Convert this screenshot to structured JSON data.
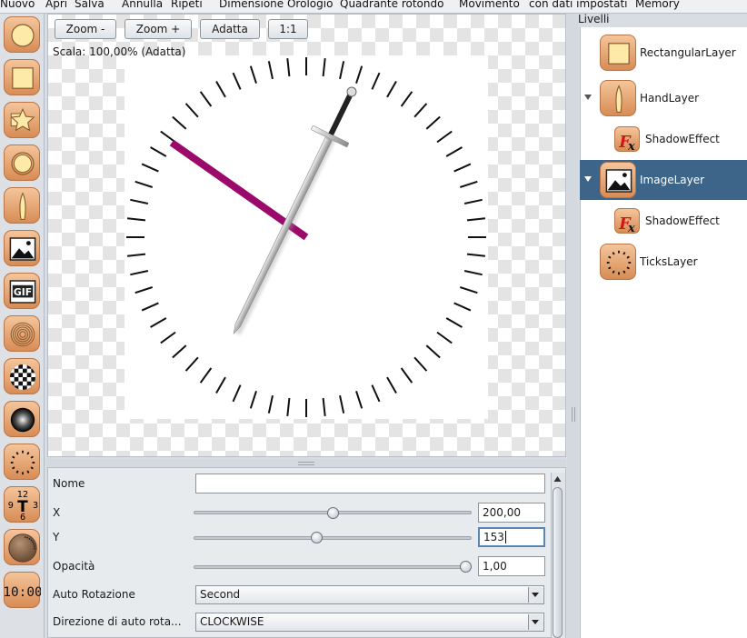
{
  "menubar": {
    "items": [
      "Nuovo",
      "Apri",
      "Salva",
      "Annulla",
      "Ripeti",
      "Dimensione Orologio",
      "Quadrante rotondo",
      "Movimento",
      "con dati impostati",
      "Memory"
    ]
  },
  "palette": {
    "tools": [
      {
        "name": "ellipse-layer-tool",
        "icon": "circle-icon"
      },
      {
        "name": "rectangle-layer-tool",
        "icon": "square-icon"
      },
      {
        "name": "shape-layer-tool",
        "icon": "star-icon"
      },
      {
        "name": "ring-layer-tool",
        "icon": "ring-icon"
      },
      {
        "name": "hand-layer-tool",
        "icon": "hand-icon"
      },
      {
        "name": "image-layer-tool",
        "icon": "image-icon"
      },
      {
        "name": "gif-layer-tool",
        "icon": "gif-icon"
      },
      {
        "name": "concentric-layer-tool",
        "icon": "concentric-circles-icon"
      },
      {
        "name": "checker-layer-tool",
        "icon": "checker-icon"
      },
      {
        "name": "gradient-layer-tool",
        "icon": "sphere-icon"
      },
      {
        "name": "ticks-layer-tool",
        "icon": "ticks-icon"
      },
      {
        "name": "numbers-layer-tool",
        "icon": "clock-numbers-icon"
      },
      {
        "name": "text-circle-layer-tool",
        "icon": "text-circle-icon"
      },
      {
        "name": "digital-layer-tool",
        "icon": "digital-clock-icon"
      }
    ],
    "numbers_icon_digits": [
      "12",
      "9",
      "3",
      "6",
      "T"
    ],
    "digital_icon_text": "10:00"
  },
  "zoom": {
    "zoom_out": "Zoom -",
    "zoom_in": "Zoom +",
    "fit": "Adatta",
    "one_to_one": "1:1",
    "scale_text": "Scala:  100,00%  (Adatta)"
  },
  "properties": {
    "name_label": "Nome",
    "name_value": "",
    "x_label": "X",
    "x_value": "200,00",
    "x_slider": 0.5,
    "y_label": "Y",
    "y_value": "153",
    "y_slider": 0.44,
    "opacity_label": "Opacità",
    "opacity_value": "1,00",
    "opacity_slider": 1.0,
    "auto_rotation_label": "Auto Rotazione",
    "auto_rotation_value": "Second",
    "auto_rotation_dir_label": "Direzione di auto rota...",
    "auto_rotation_dir_value": "CLOCKWISE"
  },
  "layers": {
    "title": "Livelli",
    "items": [
      {
        "label": "RectangularLayer",
        "kind": "layer",
        "icon": "square-icon",
        "selected": false,
        "expanded": null
      },
      {
        "label": "HandLayer",
        "kind": "layer",
        "icon": "hand-icon",
        "selected": false,
        "expanded": true
      },
      {
        "label": "ShadowEffect",
        "kind": "effect",
        "icon": "fx-icon",
        "selected": false,
        "expanded": null
      },
      {
        "label": "ImageLayer",
        "kind": "layer",
        "icon": "image-icon",
        "selected": true,
        "expanded": true
      },
      {
        "label": "ShadowEffect",
        "kind": "effect",
        "icon": "fx-icon",
        "selected": false,
        "expanded": null
      },
      {
        "label": "TicksLayer",
        "kind": "layer",
        "icon": "ticks-icon",
        "selected": false,
        "expanded": null
      }
    ]
  },
  "clock": {
    "tick_count": 60,
    "hand_color": "#9b0a6a",
    "hand_angle_deg": -58,
    "sword_angle_deg": 26
  },
  "colors": {
    "selection": "#3c6589",
    "tool_orange": "#e39a63"
  }
}
